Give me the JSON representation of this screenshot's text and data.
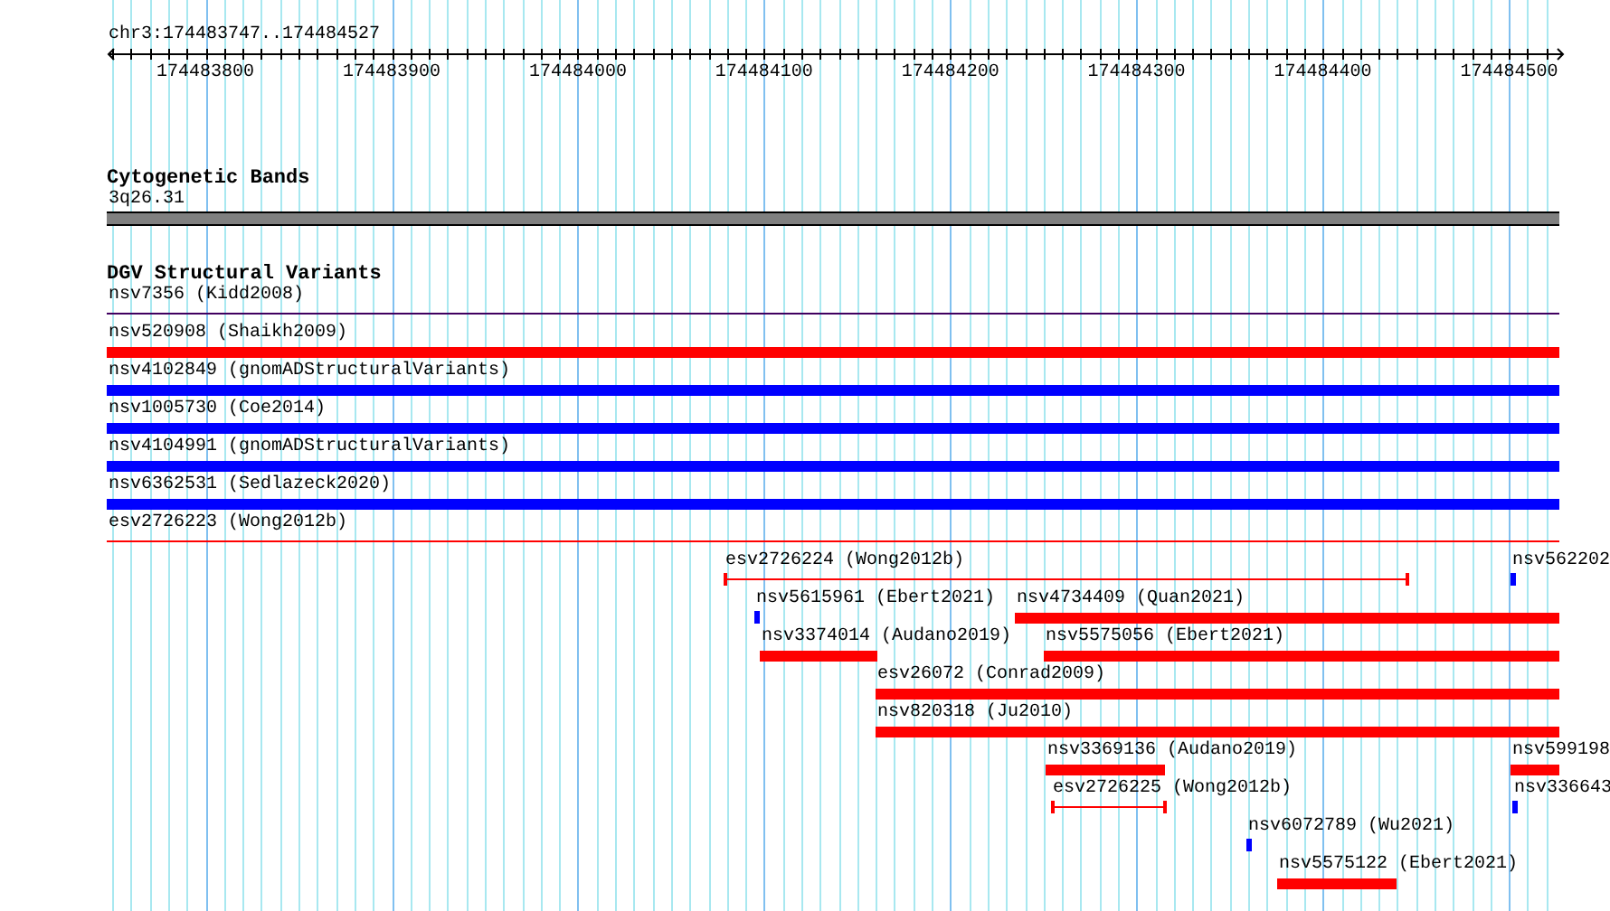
{
  "ruler": {
    "location": "chr3:174483747..174484527",
    "ticks": [
      "174483800",
      "174483900",
      "174484000",
      "174484100",
      "174484200",
      "174484300",
      "174484400",
      "174484500"
    ]
  },
  "tracks": [
    {
      "title": "Cytogenetic Bands",
      "features": [
        {
          "label": "3q26.31",
          "kind": "band",
          "color": "#808080"
        }
      ]
    },
    {
      "title": "DGV Structural Variants",
      "features": [
        {
          "label": "nsv7356 (Kidd2008)",
          "kind": "line",
          "color": "#400060"
        },
        {
          "label": "nsv520908 (Shaikh2009)",
          "kind": "bar",
          "color": "#ff0000"
        },
        {
          "label": "nsv4102849 (gnomADStructuralVariants)",
          "kind": "bar",
          "color": "#0000ff"
        },
        {
          "label": "nsv1005730 (Coe2014)",
          "kind": "bar",
          "color": "#0000ff"
        },
        {
          "label": "nsv4104991 (gnomADStructuralVariants)",
          "kind": "bar",
          "color": "#0000ff"
        },
        {
          "label": "nsv6362531 (Sedlazeck2020)",
          "kind": "bar",
          "color": "#0000ff"
        },
        {
          "label": "esv2726223 (Wong2012b)",
          "kind": "line",
          "color": "#ff0000"
        },
        {
          "label": "esv2726224 (Wong2012b)",
          "kind": "span",
          "color": "#ff0000"
        },
        {
          "label": "nsv562202",
          "kind": "tick",
          "color": "#0000ff"
        },
        {
          "label": "nsv5615961 (Ebert2021)",
          "kind": "tick",
          "color": "#0000ff"
        },
        {
          "label": "nsv4734409 (Quan2021)",
          "kind": "bar",
          "color": "#ff0000"
        },
        {
          "label": "nsv3374014 (Audano2019)",
          "kind": "bar",
          "color": "#ff0000"
        },
        {
          "label": "nsv5575056 (Ebert2021)",
          "kind": "bar",
          "color": "#ff0000"
        },
        {
          "label": "esv26072 (Conrad2009)",
          "kind": "bar",
          "color": "#ff0000"
        },
        {
          "label": "nsv820318 (Ju2010)",
          "kind": "bar",
          "color": "#ff0000"
        },
        {
          "label": "nsv3369136 (Audano2019)",
          "kind": "bar",
          "color": "#ff0000"
        },
        {
          "label": "nsv599198",
          "kind": "bar",
          "color": "#ff0000"
        },
        {
          "label": "esv2726225 (Wong2012b)",
          "kind": "span",
          "color": "#ff0000"
        },
        {
          "label": "nsv336643",
          "kind": "tick",
          "color": "#0000ff"
        },
        {
          "label": "nsv6072789 (Wu2021)",
          "kind": "tick",
          "color": "#0000ff"
        },
        {
          "label": "nsv5575122 (Ebert2021)",
          "kind": "bar",
          "color": "#ff0000"
        }
      ]
    }
  ]
}
